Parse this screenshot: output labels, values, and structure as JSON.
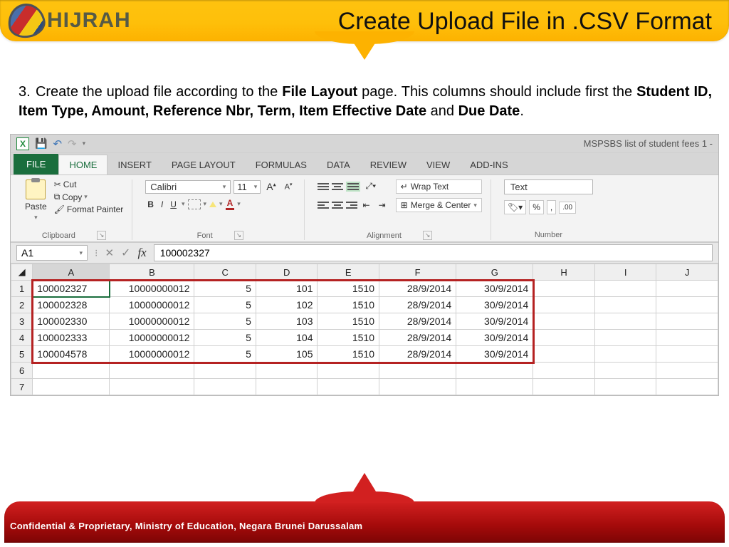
{
  "banner": {
    "logo_text": "HIJRAH",
    "title": "Create Upload File in .CSV Format"
  },
  "instruction": {
    "number": "3.",
    "pre": "Create the upload file according to the ",
    "b1": "File Layout",
    "mid1": " page. This columns should include first the ",
    "b2": "Student ID, Item Type, Amount, Reference Nbr, Term, Item Effective Date",
    "mid2": " and ",
    "b3": "Due Date",
    "post": "."
  },
  "excel": {
    "file_title": "MSPSBS list of student fees 1 -",
    "tabs": {
      "file": "FILE",
      "home": "HOME",
      "insert": "INSERT",
      "page": "PAGE LAYOUT",
      "formulas": "FORMULAS",
      "data": "DATA",
      "review": "REVIEW",
      "view": "VIEW",
      "addins": "ADD-INS"
    },
    "clipboard": {
      "paste": "Paste",
      "cut": "Cut",
      "copy": "Copy",
      "fmt": "Format Painter",
      "label": "Clipboard"
    },
    "font": {
      "name": "Calibri",
      "size": "11",
      "b": "B",
      "i": "I",
      "u": "U",
      "a_grow": "A",
      "a_shrink": "A",
      "label": "Font"
    },
    "align": {
      "wrap": "Wrap Text",
      "merge": "Merge & Center",
      "label": "Alignment"
    },
    "number": {
      "format": "Text",
      "pct": "%",
      "label": "Number"
    },
    "name_box": "A1",
    "fx": "fx",
    "fx_val": "100002327",
    "cols": [
      "A",
      "B",
      "C",
      "D",
      "E",
      "F",
      "G",
      "H",
      "I",
      "J"
    ],
    "rows": [
      {
        "n": "1",
        "c": [
          "100002327",
          "10000000012",
          "5",
          "101",
          "1510",
          "28/9/2014",
          "30/9/2014",
          "",
          "",
          ""
        ]
      },
      {
        "n": "2",
        "c": [
          "100002328",
          "10000000012",
          "5",
          "102",
          "1510",
          "28/9/2014",
          "30/9/2014",
          "",
          "",
          ""
        ]
      },
      {
        "n": "3",
        "c": [
          "100002330",
          "10000000012",
          "5",
          "103",
          "1510",
          "28/9/2014",
          "30/9/2014",
          "",
          "",
          ""
        ]
      },
      {
        "n": "4",
        "c": [
          "100002333",
          "10000000012",
          "5",
          "104",
          "1510",
          "28/9/2014",
          "30/9/2014",
          "",
          "",
          ""
        ]
      },
      {
        "n": "5",
        "c": [
          "100004578",
          "10000000012",
          "5",
          "105",
          "1510",
          "28/9/2014",
          "30/9/2014",
          "",
          "",
          ""
        ]
      },
      {
        "n": "6",
        "c": [
          "",
          "",
          "",
          "",
          "",
          "",
          "",
          "",
          "",
          ""
        ]
      },
      {
        "n": "7",
        "c": [
          "",
          "",
          "",
          "",
          "",
          "",
          "",
          "",
          "",
          ""
        ]
      }
    ]
  },
  "footer": {
    "conf": "Confidential & Proprietary, Ministry of Education, Negara Brunei Darussalam"
  }
}
